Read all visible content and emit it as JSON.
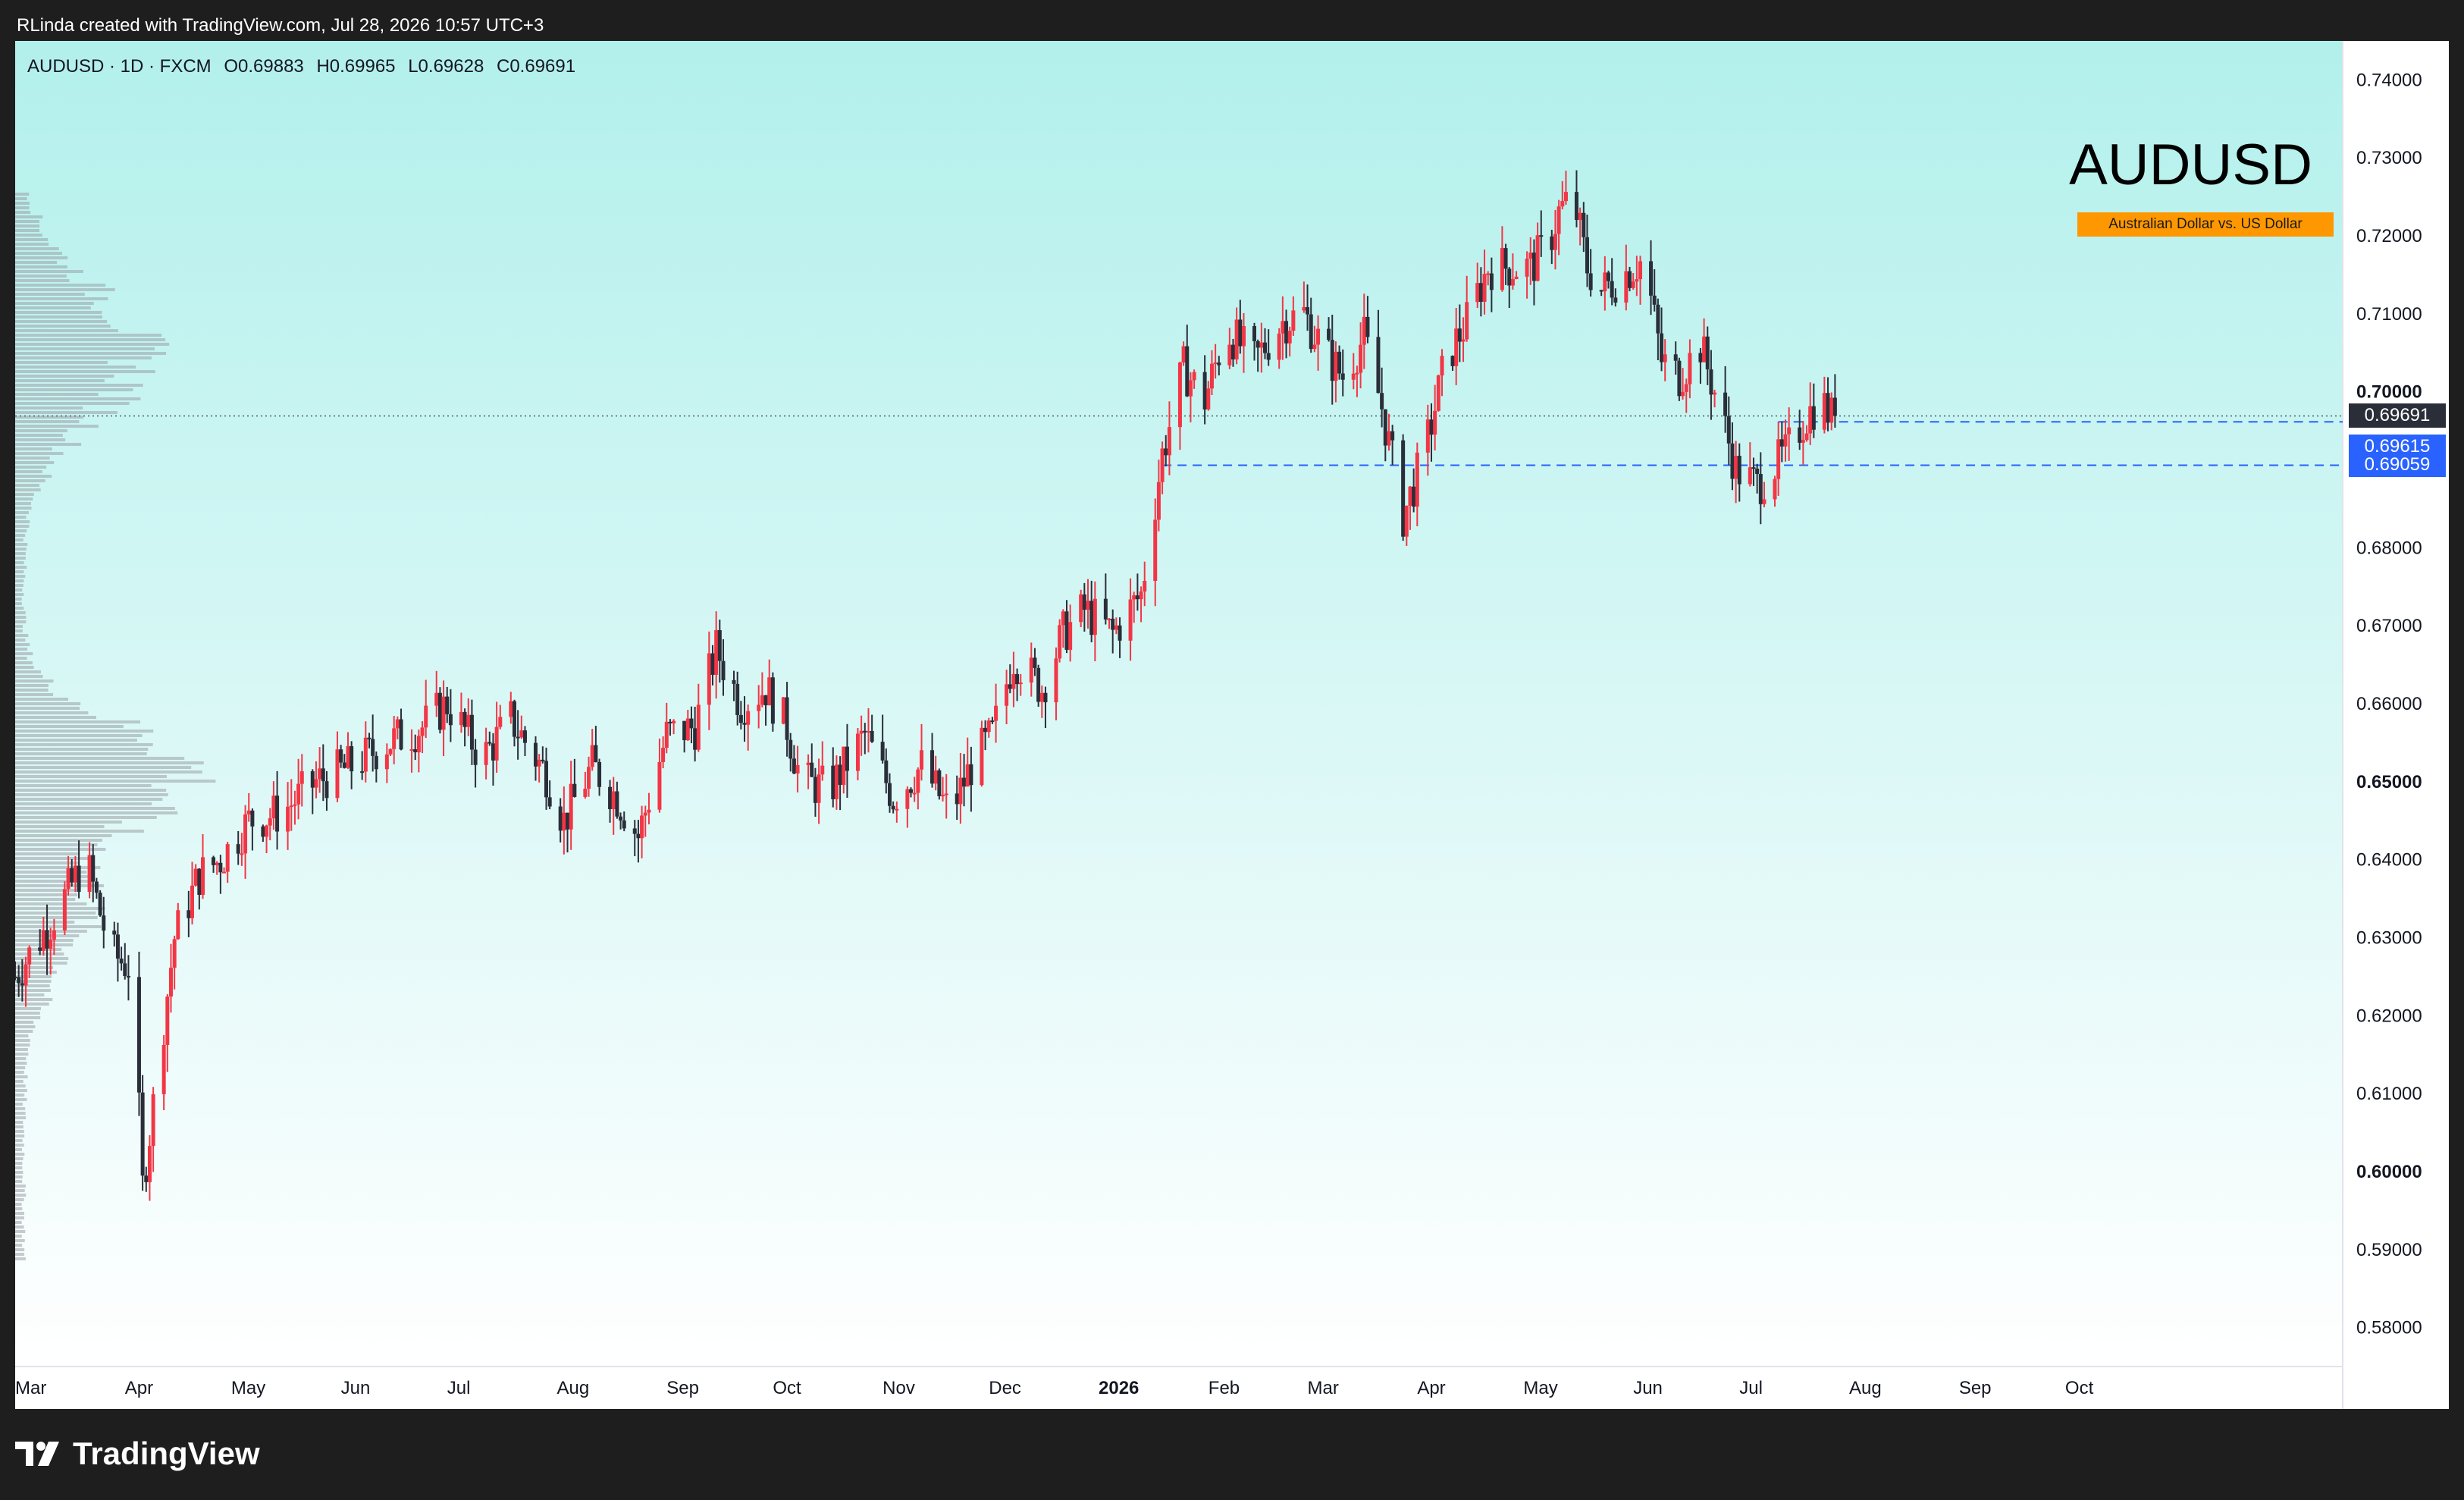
{
  "caption": "RLinda created with TradingView.com, Jul 28, 2026 10:57 UTC+3",
  "header": {
    "symbol": "AUDUSD · 1D · FXCM",
    "open": "O0.69883",
    "high": "H0.69965",
    "low": "L0.69628",
    "close": "C0.69691"
  },
  "watermark": {
    "title": "AUDUSD",
    "subtitle": "Australian Dollar vs. US Dollar"
  },
  "price_tags": {
    "last": "0.69691",
    "level_1": "0.69615",
    "level_2": "0.69059"
  },
  "footer": {
    "brand": "TradingView",
    "logo_icon": "tradingview-logo-icon"
  },
  "colors": {
    "up": "#f23645",
    "down": "#2a2e39",
    "bg_top": "#b2f0ec",
    "bg_bottom": "#ffffff",
    "level_line": "#2962ff",
    "last_tag": "#2a2e39",
    "level_tag": "#2962ff",
    "volume_profile": "#9aa0a6"
  },
  "chart_data": {
    "type": "candlestick",
    "symbol": "AUDUSD",
    "interval": "1D",
    "ylim": [
      0.575,
      0.745
    ],
    "y_ticks": [
      "0.74000",
      "0.73000",
      "0.72000",
      "0.71000",
      "0.70000",
      "0.69000",
      "0.68000",
      "0.67000",
      "0.66000",
      "0.65000",
      "0.64000",
      "0.63000",
      "0.62000",
      "0.61000",
      "0.60000",
      "0.59000",
      "0.58000"
    ],
    "bold_ticks": [
      "0.70000",
      "0.65000",
      "0.60000"
    ],
    "x_ticks": [
      "Mar",
      "Apr",
      "May",
      "Jun",
      "Jul",
      "Aug",
      "Sep",
      "Oct",
      "Nov",
      "Dec",
      "2026",
      "Feb",
      "Mar",
      "Apr",
      "May",
      "Jun",
      "Jul",
      "Aug",
      "Sep",
      "Oct"
    ],
    "bold_x_ticks": [
      "2026"
    ],
    "x_tick_days": [
      0,
      31,
      61,
      92,
      122,
      153,
      184,
      214,
      245,
      275,
      306,
      337,
      365,
      396,
      426,
      457,
      487,
      518,
      549,
      579
    ],
    "last_price": 0.69691,
    "levels": [
      0.69615,
      0.69059
    ],
    "anchors": [
      [
        0,
        0.625
      ],
      [
        10,
        0.632
      ],
      [
        20,
        0.64
      ],
      [
        27,
        0.628
      ],
      [
        33,
        0.626
      ],
      [
        36,
        0.598
      ],
      [
        40,
        0.612
      ],
      [
        45,
        0.63
      ],
      [
        52,
        0.638
      ],
      [
        58,
        0.64
      ],
      [
        66,
        0.645
      ],
      [
        75,
        0.646
      ],
      [
        85,
        0.65
      ],
      [
        95,
        0.652
      ],
      [
        105,
        0.655
      ],
      [
        115,
        0.657
      ],
      [
        122,
        0.66
      ],
      [
        132,
        0.653
      ],
      [
        140,
        0.658
      ],
      [
        150,
        0.651
      ],
      [
        155,
        0.645
      ],
      [
        163,
        0.652
      ],
      [
        170,
        0.648
      ],
      [
        176,
        0.643
      ],
      [
        184,
        0.656
      ],
      [
        192,
        0.657
      ],
      [
        198,
        0.667
      ],
      [
        205,
        0.66
      ],
      [
        212,
        0.662
      ],
      [
        218,
        0.657
      ],
      [
        222,
        0.65
      ],
      [
        230,
        0.649
      ],
      [
        240,
        0.656
      ],
      [
        248,
        0.648
      ],
      [
        256,
        0.652
      ],
      [
        264,
        0.646
      ],
      [
        270,
        0.652
      ],
      [
        276,
        0.656
      ],
      [
        282,
        0.666
      ],
      [
        290,
        0.662
      ],
      [
        296,
        0.669
      ],
      [
        302,
        0.672
      ],
      [
        310,
        0.669
      ],
      [
        318,
        0.674
      ],
      [
        324,
        0.692
      ],
      [
        330,
        0.703
      ],
      [
        336,
        0.699
      ],
      [
        342,
        0.708
      ],
      [
        350,
        0.704
      ],
      [
        358,
        0.709
      ],
      [
        364,
        0.71
      ],
      [
        370,
        0.705
      ],
      [
        375,
        0.702
      ],
      [
        381,
        0.707
      ],
      [
        386,
        0.698
      ],
      [
        392,
        0.684
      ],
      [
        398,
        0.692
      ],
      [
        404,
        0.704
      ],
      [
        410,
        0.709
      ],
      [
        416,
        0.716
      ],
      [
        422,
        0.716
      ],
      [
        428,
        0.716
      ],
      [
        433,
        0.719
      ],
      [
        436,
        0.723
      ],
      [
        440,
        0.725
      ],
      [
        444,
        0.716
      ],
      [
        448,
        0.713
      ],
      [
        454,
        0.715
      ],
      [
        460,
        0.717
      ],
      [
        465,
        0.704
      ],
      [
        470,
        0.702
      ],
      [
        476,
        0.706
      ],
      [
        482,
        0.697
      ],
      [
        486,
        0.69
      ],
      [
        492,
        0.688
      ],
      [
        500,
        0.692
      ],
      [
        506,
        0.697
      ],
      [
        510,
        0.699
      ],
      [
        514,
        0.696
      ]
    ]
  }
}
